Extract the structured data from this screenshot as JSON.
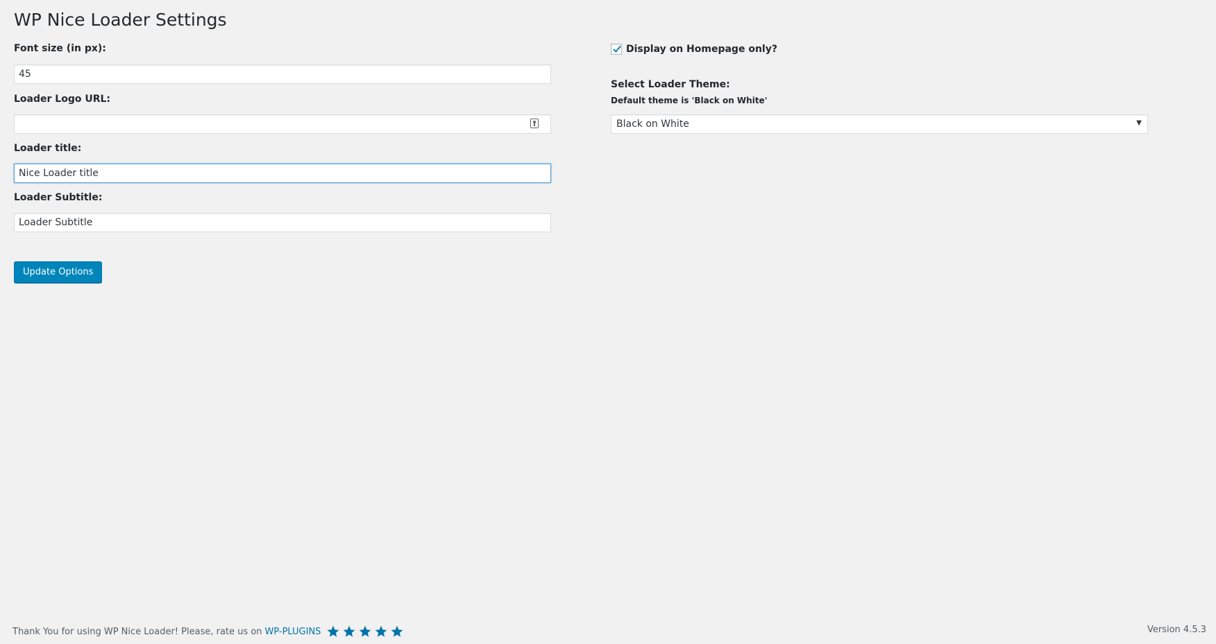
{
  "page": {
    "title": "WP Nice Loader Settings"
  },
  "form": {
    "font_size": {
      "label": "Font size (in px):",
      "value": "45"
    },
    "logo_url": {
      "label": "Loader Logo URL:",
      "value": ""
    },
    "loader_title": {
      "label": "Loader title:",
      "value": "Nice Loader title"
    },
    "loader_subtitle": {
      "label": "Loader Subtitle:",
      "value": "Loader Subtitle"
    },
    "homepage_only": {
      "label": "Display on Homepage only?",
      "checked": true
    },
    "theme": {
      "label": "Select Loader Theme:",
      "hint": "Default theme is 'Black on White'",
      "selected": "Black on White"
    },
    "submit_label": "Update Options"
  },
  "footer": {
    "thanks_text": "Thank You for using WP Nice Loader! Please, rate us on",
    "link_text": "WP-PLUGINS",
    "star_rating": 5,
    "version": "Version 4.5.3"
  },
  "colors": {
    "accent": "#0085ba",
    "link": "#0073aa",
    "background": "#f1f1f1"
  }
}
